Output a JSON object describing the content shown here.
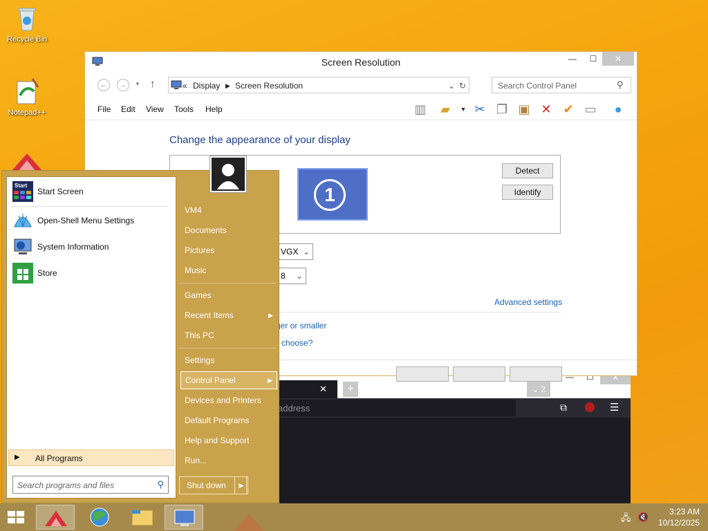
{
  "desktop": {
    "recycle_bin": "Recycle Bin",
    "notepad": "Notepad++"
  },
  "control_panel": {
    "title": "Screen Resolution",
    "breadcrumb_prefix": "«",
    "breadcrumb": [
      "Display",
      "Screen Resolution"
    ],
    "search_placeholder": "Search Control Panel",
    "menu": [
      "File",
      "Edit",
      "View",
      "Tools",
      "Help"
    ],
    "heading": "Change the appearance of your display",
    "monitor_number": "1",
    "detect": "Detect",
    "identify": "Identify",
    "display_select": "VGX",
    "orientation_select": "8",
    "advanced": "Advanced settings",
    "link_larger": "ger or smaller",
    "link_choose": "choose?"
  },
  "browser": {
    "tab_close": "✕",
    "new_tab": "+",
    "tab_count": "2",
    "url_placeholder": "address"
  },
  "start_menu": {
    "programs": [
      {
        "label": "Start Screen",
        "icon": "start-screen-icon"
      },
      {
        "label": "Open-Shell Menu Settings",
        "icon": "shell-icon"
      },
      {
        "label": "System Information",
        "icon": "system-info-icon"
      },
      {
        "label": "Store",
        "icon": "store-icon"
      }
    ],
    "start_badge": "Start",
    "all_programs": "All Programs",
    "search_placeholder": "Search programs and files",
    "right": [
      "VM4",
      "Documents",
      "Pictures",
      "Music",
      "Games",
      "Recent Items",
      "This PC",
      "Settings",
      "Control Panel",
      "Devices and Printers",
      "Default Programs",
      "Help and Support",
      "Run..."
    ],
    "shutdown": "Shut down"
  },
  "taskbar": {
    "time": "3:23 AM",
    "date": "10/12/2025"
  }
}
